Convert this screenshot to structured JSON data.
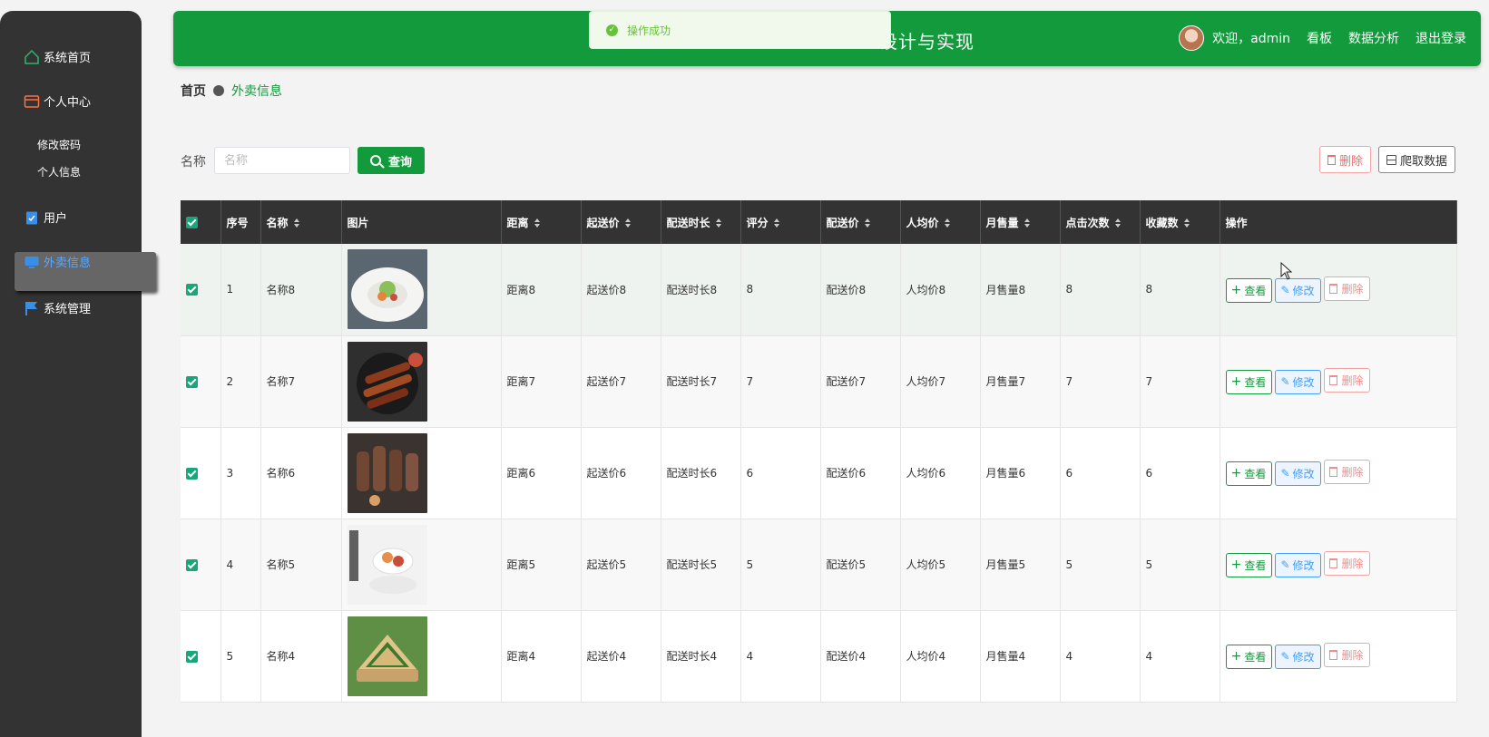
{
  "sidebar": {
    "items": [
      {
        "label": "系统首页",
        "icon": "home-icon",
        "color": "#2bb673"
      },
      {
        "label": "个人中心",
        "icon": "wallet-icon",
        "color": "#ff7043"
      },
      {
        "label": "修改密码"
      },
      {
        "label": "个人信息"
      },
      {
        "label": "用户",
        "icon": "clipboard-icon",
        "color": "#3a8ee6"
      },
      {
        "label": "外卖信息",
        "icon": "monitor-icon",
        "color": "#3a8ee6"
      },
      {
        "label": "系统管理",
        "icon": "flag-icon",
        "color": "#3a8ee6"
      }
    ]
  },
  "header": {
    "title": "设计与实现",
    "welcome": "欢迎，admin",
    "board": "看板",
    "analysis": "数据分析",
    "logout": "退出登录"
  },
  "toast": {
    "text": "操作成功"
  },
  "breadcrumb": {
    "home": "首页",
    "current": "外卖信息"
  },
  "search": {
    "label": "名称",
    "placeholder": "名称",
    "button": "查询"
  },
  "toolbar": {
    "delete": "删除",
    "crawl": "爬取数据"
  },
  "table": {
    "columns": [
      "序号",
      "名称",
      "图片",
      "距离",
      "起送价",
      "配送时长",
      "评分",
      "配送价",
      "人均价",
      "月售量",
      "点击次数",
      "收藏数",
      "操作"
    ],
    "rows": [
      {
        "index": "1",
        "name": "名称8",
        "distance": "距离8",
        "min_price": "起送价8",
        "delivery_time": "配送时长8",
        "score": "8",
        "delivery_fee": "配送价8",
        "avg_price": "人均价8",
        "monthly_sales": "月售量8",
        "clicks": "8",
        "favorites": "8"
      },
      {
        "index": "2",
        "name": "名称7",
        "distance": "距离7",
        "min_price": "起送价7",
        "delivery_time": "配送时长7",
        "score": "7",
        "delivery_fee": "配送价7",
        "avg_price": "人均价7",
        "monthly_sales": "月售量7",
        "clicks": "7",
        "favorites": "7"
      },
      {
        "index": "3",
        "name": "名称6",
        "distance": "距离6",
        "min_price": "起送价6",
        "delivery_time": "配送时长6",
        "score": "6",
        "delivery_fee": "配送价6",
        "avg_price": "人均价6",
        "monthly_sales": "月售量6",
        "clicks": "6",
        "favorites": "6"
      },
      {
        "index": "4",
        "name": "名称5",
        "distance": "距离5",
        "min_price": "起送价5",
        "delivery_time": "配送时长5",
        "score": "5",
        "delivery_fee": "配送价5",
        "avg_price": "人均价5",
        "monthly_sales": "月售量5",
        "clicks": "5",
        "favorites": "5"
      },
      {
        "index": "5",
        "name": "名称4",
        "distance": "距离4",
        "min_price": "起送价4",
        "delivery_time": "配送时长4",
        "score": "4",
        "delivery_fee": "配送价4",
        "avg_price": "人均价4",
        "monthly_sales": "月售量4",
        "clicks": "4",
        "favorites": "4"
      }
    ],
    "actions": {
      "view": "查看",
      "edit": "修改",
      "delete": "删除"
    }
  },
  "colors": {
    "primary": "#129a3c",
    "sidebar": "#333333",
    "edit": "#409eff",
    "danger": "#f56c6c"
  }
}
